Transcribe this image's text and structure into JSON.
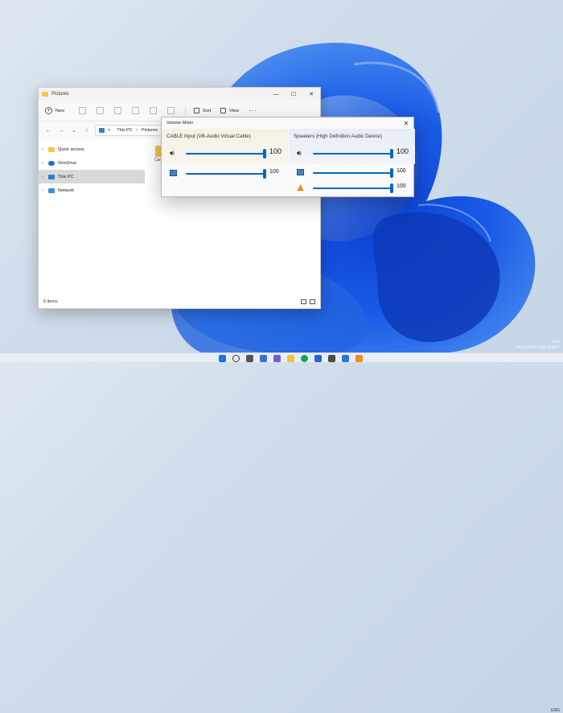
{
  "explorer": {
    "title": "Pictures",
    "controls": {
      "minimize": "—",
      "maximize": "☐",
      "close": "✕"
    },
    "toolbar": {
      "new_label": "New",
      "new_icon": "plus-circle-icon",
      "sort_label": "Sort",
      "view_label": "View",
      "more_label": "···"
    },
    "address": {
      "root": "This PC",
      "current": "Pictures",
      "separator": ">"
    },
    "nav": [
      {
        "label": "Quick access",
        "icon": "star-icon",
        "color": "#f4c84b"
      },
      {
        "label": "OneDrive",
        "icon": "cloud-icon",
        "color": "#1f6fc9"
      },
      {
        "label": "This PC",
        "icon": "pc-icon",
        "color": "#2d7fd3",
        "selected": true
      },
      {
        "label": "Network",
        "icon": "network-icon",
        "color": "#3f8ad8"
      }
    ],
    "content": {
      "folder_label": "Cam R"
    },
    "status": {
      "items": "5 items"
    }
  },
  "mixer": {
    "title": "Volume Mixer",
    "close": "✕",
    "columns": [
      {
        "device": "CABLE Input (VB-Audio Virtual Cable)",
        "rows": [
          {
            "icon": "speaker-icon",
            "value": "100",
            "level": 1.0
          },
          {
            "icon": "system-sounds-icon",
            "value": "100",
            "level": 1.0
          }
        ]
      },
      {
        "device": "Speakers (High Definition Audio Device)",
        "rows": [
          {
            "icon": "speaker-icon",
            "value": "100",
            "level": 1.0
          },
          {
            "icon": "system-sounds-icon",
            "value": "100",
            "level": 1.0
          },
          {
            "icon": "vlc-icon",
            "value": "100",
            "level": 1.0
          }
        ]
      }
    ]
  },
  "desktop": {
    "watermark": [
      "Eval",
      "Evaluation copy. Build 2"
    ],
    "tray": "ENG"
  },
  "colors": {
    "accent": "#0067c0",
    "taskbar": "#e9eef5"
  }
}
